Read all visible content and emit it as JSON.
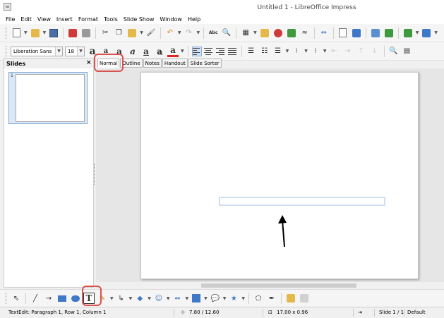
{
  "window": {
    "title": "Untitled 1 - LibreOffice Impress",
    "app_icon": "impress-app-icon"
  },
  "menu": [
    "File",
    "Edit",
    "View",
    "Insert",
    "Format",
    "Tools",
    "Slide Show",
    "Window",
    "Help"
  ],
  "standard_toolbar": {
    "icons": [
      "new-icon",
      "open-icon",
      "save-icon",
      "export-pdf-icon",
      "print-icon",
      "cut-icon",
      "copy-icon",
      "paste-icon",
      "clone-formatting-icon",
      "undo-icon",
      "redo-icon",
      "spelling-icon",
      "zoom-icon",
      "display-grid-icon",
      "image-icon",
      "chart-icon",
      "table-icon",
      "media-icon",
      "hyperlink-icon",
      "slide-layout-icon",
      "master-slide-icon",
      "start-slideshow-icon",
      "start-from-current-icon",
      "new-slide-icon",
      "duplicate-slide-icon"
    ],
    "spelling_label": "Abc"
  },
  "formatting_toolbar": {
    "font_name": "Liberation Sans",
    "font_size": "18",
    "format_glyphs": {
      "grow": "a",
      "shrink": "a",
      "bold": "a",
      "italic": "a",
      "underline": "a",
      "shadow": "a",
      "font_color": "a"
    },
    "icons": [
      "grow-font-icon",
      "shrink-font-icon",
      "bold-icon",
      "italic-icon",
      "underline-icon",
      "shadow-icon",
      "font-color-icon",
      "align-left-icon",
      "align-center-icon",
      "align-right-icon",
      "justify-icon",
      "bullets-icon",
      "numbering-icon",
      "line-spacing-icon",
      "increase-paragraph-spacing-icon",
      "decrease-paragraph-spacing-icon",
      "character-icon",
      "paragraph-icon"
    ]
  },
  "slides_pane": {
    "title": "Slides",
    "close": "×",
    "thumbnails": [
      {
        "number": "1",
        "selected": true
      }
    ]
  },
  "view_tabs": [
    {
      "label": "Normal",
      "active": true
    },
    {
      "label": "Outline"
    },
    {
      "label": "Notes"
    },
    {
      "label": "Handout"
    },
    {
      "label": "Slide Sorter"
    }
  ],
  "drawing_toolbar": {
    "icons": [
      "select-icon",
      "line-icon",
      "line-ends-arrow-icon",
      "rectangle-icon",
      "ellipse-icon",
      "text-icon",
      "curve-icon",
      "connector-icon",
      "basic-shapes-icon",
      "symbol-shapes-icon",
      "block-arrows-icon",
      "flowchart-icon",
      "callouts-icon",
      "stars-icon",
      "points-icon",
      "glue-points-icon",
      "fontwork-icon",
      "3d-objects-icon"
    ],
    "text_tool_label": "T"
  },
  "status": {
    "edit_info": "TextEdit: Paragraph 1, Row 1, Column 1",
    "position": "7.80 / 12.60",
    "size": "17.00 x 0.96",
    "slide": "Slide 1 / 1",
    "master": "Default"
  },
  "annotation_color": "#d9534f",
  "selection_color": "#cfe0f5"
}
